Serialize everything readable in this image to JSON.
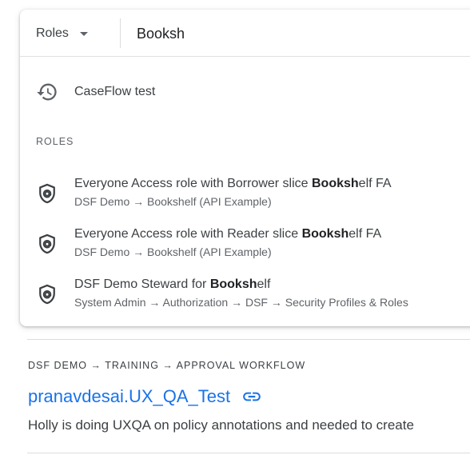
{
  "search": {
    "scope_label": "Roles",
    "query": "Booksh"
  },
  "recent": {
    "label": "CaseFlow test",
    "icon": "history-icon"
  },
  "roles_section": {
    "heading": "ROLES",
    "icon": "shield-at-icon",
    "items": [
      {
        "title_before": "Everyone Access role with Borrower slice ",
        "title_match": "Booksh",
        "title_after": "elf FA",
        "path": "DSF Demo → Bookshelf (API Example)"
      },
      {
        "title_before": "Everyone Access role with Reader slice ",
        "title_match": "Booksh",
        "title_after": "elf FA",
        "path": "DSF Demo → Bookshelf (API Example)"
      },
      {
        "title_before": "DSF Demo Steward for ",
        "title_match": "Booksh",
        "title_after": "elf",
        "path": "System Admin → Authorization → DSF → Security Profiles & Roles"
      }
    ]
  },
  "result": {
    "breadcrumb": "DSF DEMO → TRAINING → APPROVAL WORKFLOW",
    "title": "pranavdesai.UX_QA_Test",
    "link_icon": "link-icon",
    "description": "Holly is doing UXQA on policy annotations and needed to create"
  },
  "colors": {
    "link": "#1a73e8",
    "text": "#3c4043",
    "muted": "#5f6368",
    "divider": "#dadce0"
  }
}
